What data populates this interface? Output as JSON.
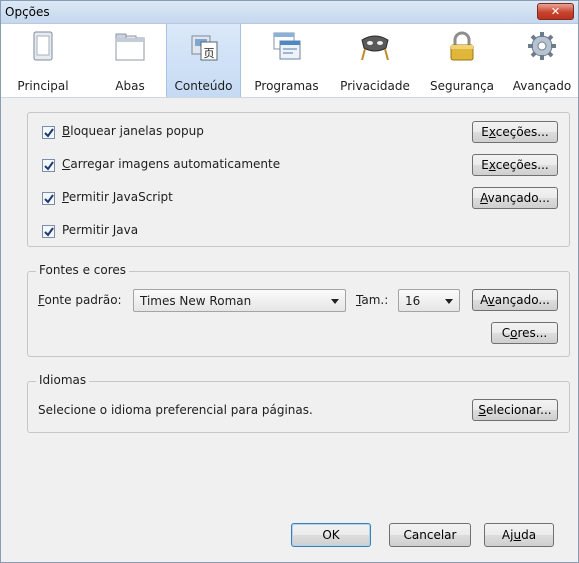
{
  "window": {
    "title": "Opções",
    "close_glyph": "✕"
  },
  "toolbar": {
    "items": [
      {
        "label": "Principal",
        "icon": "switch-icon",
        "active": false
      },
      {
        "label": "Abas",
        "icon": "tabs-window-icon",
        "active": false
      },
      {
        "label": "Conteúdo",
        "icon": "content-page-icon",
        "active": true
      },
      {
        "label": "Programas",
        "icon": "applications-icon",
        "active": false
      },
      {
        "label": "Privacidade",
        "icon": "mask-icon",
        "active": false
      },
      {
        "label": "Segurança",
        "icon": "padlock-icon",
        "active": false
      },
      {
        "label": "Avançado",
        "icon": "gear-icon",
        "active": false
      }
    ]
  },
  "content": {
    "checkboxes": [
      {
        "accel": "B",
        "rest": "loquear janelas popup",
        "checked": true
      },
      {
        "accel": "C",
        "rest": "arregar imagens automaticamente",
        "checked": true
      },
      {
        "accel": "P",
        "rest": "ermitir JavaScript",
        "checked": true
      },
      {
        "pre": "Permitir ",
        "accel": "J",
        "rest": "ava",
        "checked": true
      }
    ],
    "buttons": {
      "exceptions1": {
        "pre": "E",
        "accel": "x",
        "rest": "ceções..."
      },
      "exceptions2": {
        "pre": "E",
        "accel": "x",
        "rest": "ceções..."
      },
      "advanced_js": {
        "pre": "",
        "accel": "A",
        "rest": "vançado..."
      }
    }
  },
  "fonts": {
    "legend": "Fontes e cores",
    "default_font_label": {
      "accel": "F",
      "rest": "onte padrão:"
    },
    "default_font_value": "Times New Roman",
    "size_label": {
      "accel": "T",
      "rest": "am.:"
    },
    "size_value": "16",
    "advanced_button": {
      "pre": "A",
      "accel": "v",
      "rest": "ançado..."
    },
    "colors_button": {
      "pre": "C",
      "accel": "o",
      "rest": "res..."
    }
  },
  "languages": {
    "legend": "Idiomas",
    "description": "Selecione o idioma preferencial para páginas.",
    "select_button": {
      "pre": "",
      "accel": "S",
      "rest": "elecionar..."
    }
  },
  "footer": {
    "ok": "OK",
    "cancel": "Cancelar",
    "help": {
      "pre": "Aj",
      "accel": "u",
      "rest": "da"
    }
  },
  "colors": {
    "check": "#1b3b73",
    "active_tab": "#c5daf3"
  }
}
